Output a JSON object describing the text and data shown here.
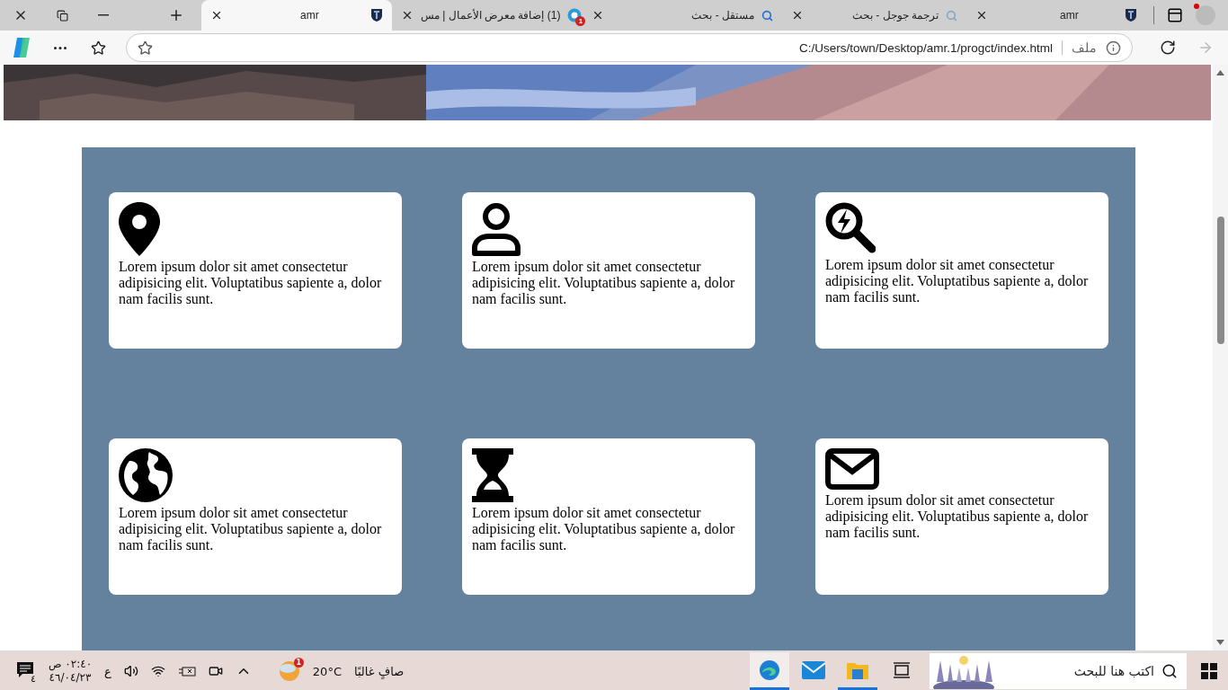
{
  "tabs": [
    {
      "title": "amr",
      "kind": "shield",
      "selected": false
    },
    {
      "title": "ترجمة جوجل - بحث",
      "kind": "search-grey",
      "selected": false
    },
    {
      "title": "مستقل - بحث",
      "kind": "search-blue",
      "selected": false
    },
    {
      "title": "(1) إضافة معرض الأعمال | مس",
      "kind": "logo",
      "badge": "1",
      "selected": false
    },
    {
      "title": "amr",
      "kind": "shield",
      "selected": true
    }
  ],
  "address": {
    "scheme": "ملف",
    "url": "C:/Users/town/Desktop/amr.1/progct/index.html"
  },
  "page": {
    "cards": [
      {
        "kind": "pin",
        "text": "Lorem ipsum dolor sit amet consectetur adipisicing elit. Voluptatibus sapiente a, dolor nam facilis sunt."
      },
      {
        "kind": "user",
        "text": "Lorem ipsum dolor sit amet consectetur adipisicing elit. Voluptatibus sapiente a, dolor nam facilis sunt."
      },
      {
        "kind": "search-bolt",
        "text": "Lorem ipsum dolor sit amet consectetur adipisicing elit. Voluptatibus sapiente a, dolor nam facilis sunt."
      },
      {
        "kind": "globe",
        "text": "Lorem ipsum dolor sit amet consectetur adipisicing elit. Voluptatibus sapiente a, dolor nam facilis sunt."
      },
      {
        "kind": "hourglass",
        "text": "Lorem ipsum dolor sit amet consectetur adipisicing elit. Voluptatibus sapiente a, dolor nam facilis sunt."
      },
      {
        "kind": "mail",
        "text": "Lorem ipsum dolor sit amet consectetur adipisicing elit. Voluptatibus sapiente a, dolor nam facilis sunt."
      }
    ]
  },
  "taskbar": {
    "notifications": "٤",
    "time": "٠٢:٤٠ ص",
    "date": "٤٦/٠٤/٢٣",
    "language": "ع",
    "weather_badge": "1",
    "temperature": "20°C",
    "weather": "صافٍ غالبًا",
    "apps": [
      {
        "kind": "edge",
        "selected": true,
        "running": true
      },
      {
        "kind": "mail",
        "selected": false,
        "running": false
      },
      {
        "kind": "explorer",
        "selected": false,
        "running": true
      },
      {
        "kind": "taskview",
        "selected": false,
        "running": false
      }
    ],
    "search_placeholder": "اكتب هنا للبحث"
  }
}
